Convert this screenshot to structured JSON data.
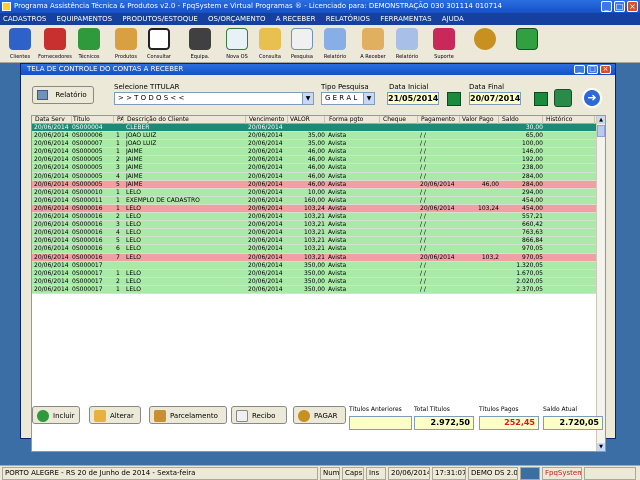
{
  "app": {
    "title": "Programa Assistência Técnica & Produtos v2.0 - FpqSystem e Virtual Programas ® - Licenciado para: DEMONSTRAÇÃO 030 301114 010714"
  },
  "menu": [
    "CADASTROS",
    "EQUIPAMENTOS",
    "PRODUTOS/ESTOQUE",
    "OS/ORÇAMENTO",
    "A RECEBER",
    "RELATÓRIOS",
    "FERRAMENTAS",
    "AJUDA"
  ],
  "toolbar": [
    {
      "label": "Clientes",
      "icon": "clients-icon"
    },
    {
      "label": "Fornecedores",
      "icon": "suppliers-icon"
    },
    {
      "label": "Técnicos",
      "icon": "technicians-icon"
    },
    {
      "label": "Produtos",
      "icon": "products-icon"
    },
    {
      "label": "Consultar",
      "icon": "barcode-icon"
    },
    {
      "label": "Equipa.",
      "icon": "equipment-icon"
    },
    {
      "label": "Nova OS",
      "icon": "new-os-icon"
    },
    {
      "label": "Consulta",
      "icon": "folder-icon"
    },
    {
      "label": "Pesquisa",
      "icon": "search-docs-icon"
    },
    {
      "label": "Relatório",
      "icon": "report-icon"
    },
    {
      "label": "A Receber",
      "icon": "receivables-icon"
    },
    {
      "label": "Relatório",
      "icon": "report2-icon"
    },
    {
      "label": "Suporte",
      "icon": "support-icon"
    },
    {
      "label": "",
      "icon": "coins-icon"
    },
    {
      "label": "",
      "icon": "exit-icon"
    }
  ],
  "window": {
    "title": "TELA DE CONTROLE DO CONTAS A RECEBER"
  },
  "filters": {
    "relatorio_label": "Relatório",
    "titular_label": "Selecione TITULAR",
    "titular_value": "> > T O D O S < <",
    "tipo_label": "Tipo  Pesquisa",
    "tipo_value": "G E R A L",
    "data_inicial_label": "Data Inicial",
    "data_inicial": "21/05/2014",
    "data_final_label": "Data Final",
    "data_final": "20/07/2014"
  },
  "table": {
    "headers": [
      "Data Serv",
      "Título",
      "PA",
      "Descrição do Cliente",
      "Vencimento",
      "VALOR",
      "Forma pgto",
      "Cheque",
      "Pagamento",
      "Valor Pago",
      "Saldo",
      "Histórico"
    ],
    "rows": [
      {
        "s": "sel",
        "d": "20/06/2014",
        "t": "0S000004",
        "pa": "",
        "cli": "CLEBER",
        "v": "20/06/2014",
        "val": "",
        "fp": "",
        "ch": "",
        "pg": "",
        "vp": "",
        "sd": "30,00",
        "h": ""
      },
      {
        "s": "g",
        "d": "20/06/2014",
        "t": "0S000006",
        "pa": "1",
        "cli": "JOÃO LUIZ",
        "v": "20/06/2014",
        "val": "35,00",
        "fp": "Avista",
        "ch": "",
        "pg": "/ /",
        "vp": "",
        "sd": "65,00",
        "h": ""
      },
      {
        "s": "g",
        "d": "20/06/2014",
        "t": "0S000007",
        "pa": "1",
        "cli": "JOÃO LUIZ",
        "v": "20/06/2014",
        "val": "35,00",
        "fp": "Avista",
        "ch": "",
        "pg": "/ /",
        "vp": "",
        "sd": "100,00",
        "h": ""
      },
      {
        "s": "g",
        "d": "20/06/2014",
        "t": "0S000005",
        "pa": "1",
        "cli": "JAIME",
        "v": "20/06/2014",
        "val": "46,00",
        "fp": "Avista",
        "ch": "",
        "pg": "/ /",
        "vp": "",
        "sd": "146,00",
        "h": ""
      },
      {
        "s": "g",
        "d": "20/06/2014",
        "t": "0S000005",
        "pa": "2",
        "cli": "JAIME",
        "v": "20/06/2014",
        "val": "46,00",
        "fp": "Avista",
        "ch": "",
        "pg": "/ /",
        "vp": "",
        "sd": "192,00",
        "h": ""
      },
      {
        "s": "g",
        "d": "20/06/2014",
        "t": "0S000005",
        "pa": "3",
        "cli": "JAIME",
        "v": "20/06/2014",
        "val": "46,00",
        "fp": "Avista",
        "ch": "",
        "pg": "/ /",
        "vp": "",
        "sd": "238,00",
        "h": ""
      },
      {
        "s": "g",
        "d": "20/06/2014",
        "t": "0S000005",
        "pa": "4",
        "cli": "JAIME",
        "v": "20/06/2014",
        "val": "46,00",
        "fp": "Avista",
        "ch": "",
        "pg": "/ /",
        "vp": "",
        "sd": "284,00",
        "h": ""
      },
      {
        "s": "r",
        "d": "20/06/2014",
        "t": "0S000005",
        "pa": "5",
        "cli": "JAIME",
        "v": "20/06/2014",
        "val": "46,00",
        "fp": "Avista",
        "ch": "",
        "pg": "20/06/2014",
        "vp": "46,00",
        "sd": "284,00",
        "h": ""
      },
      {
        "s": "g",
        "d": "20/06/2014",
        "t": "0S000010",
        "pa": "1",
        "cli": "LELO",
        "v": "20/06/2014",
        "val": "10,00",
        "fp": "Avista",
        "ch": "",
        "pg": "/ /",
        "vp": "",
        "sd": "294,00",
        "h": ""
      },
      {
        "s": "g",
        "d": "20/06/2014",
        "t": "0S000011",
        "pa": "1",
        "cli": "EXEMPLO DE CADASTRO",
        "v": "20/06/2014",
        "val": "160,00",
        "fp": "Avista",
        "ch": "",
        "pg": "/ /",
        "vp": "",
        "sd": "454,00",
        "h": ""
      },
      {
        "s": "r",
        "d": "20/06/2014",
        "t": "0S000016",
        "pa": "1",
        "cli": "LELO",
        "v": "20/06/2014",
        "val": "103,24",
        "fp": "Avista",
        "ch": "",
        "pg": "20/06/2014",
        "vp": "103,24",
        "sd": "454,00",
        "h": ""
      },
      {
        "s": "g",
        "d": "20/06/2014",
        "t": "0S000016",
        "pa": "2",
        "cli": "LELO",
        "v": "20/06/2014",
        "val": "103,21",
        "fp": "Avista",
        "ch": "",
        "pg": "/ /",
        "vp": "",
        "sd": "557,21",
        "h": ""
      },
      {
        "s": "g",
        "d": "20/06/2014",
        "t": "0S000016",
        "pa": "3",
        "cli": "LELO",
        "v": "20/06/2014",
        "val": "103,21",
        "fp": "Avista",
        "ch": "",
        "pg": "/ /",
        "vp": "",
        "sd": "660,42",
        "h": ""
      },
      {
        "s": "g",
        "d": "20/06/2014",
        "t": "0S000016",
        "pa": "4",
        "cli": "LELO",
        "v": "20/06/2014",
        "val": "103,21",
        "fp": "Avista",
        "ch": "",
        "pg": "/ /",
        "vp": "",
        "sd": "763,63",
        "h": ""
      },
      {
        "s": "g",
        "d": "20/06/2014",
        "t": "0S000016",
        "pa": "5",
        "cli": "LELO",
        "v": "20/06/2014",
        "val": "103,21",
        "fp": "Avista",
        "ch": "",
        "pg": "/ /",
        "vp": "",
        "sd": "866,84",
        "h": ""
      },
      {
        "s": "g",
        "d": "20/06/2014",
        "t": "0S000016",
        "pa": "6",
        "cli": "LELO",
        "v": "20/06/2014",
        "val": "103,21",
        "fp": "Avista",
        "ch": "",
        "pg": "/ /",
        "vp": "",
        "sd": "970,05",
        "h": ""
      },
      {
        "s": "r",
        "d": "20/06/2014",
        "t": "0S000016",
        "pa": "7",
        "cli": "LELO",
        "v": "20/06/2014",
        "val": "103,21",
        "fp": "Avista",
        "ch": "",
        "pg": "20/06/2014",
        "vp": "103,2",
        "sd": "970,05",
        "h": ""
      },
      {
        "s": "g",
        "d": "20/06/2014",
        "t": "0S000017",
        "pa": "",
        "cli": "",
        "v": "20/06/2014",
        "val": "350,00",
        "fp": "Avista",
        "ch": "",
        "pg": "/ /",
        "vp": "",
        "sd": "1.320,05",
        "h": ""
      },
      {
        "s": "g",
        "d": "20/06/2014",
        "t": "0S000017",
        "pa": "1",
        "cli": "LELO",
        "v": "20/06/2014",
        "val": "350,00",
        "fp": "Avista",
        "ch": "",
        "pg": "/ /",
        "vp": "",
        "sd": "1.670,05",
        "h": ""
      },
      {
        "s": "g",
        "d": "20/06/2014",
        "t": "0S000017",
        "pa": "2",
        "cli": "LELO",
        "v": "20/06/2014",
        "val": "350,00",
        "fp": "Avista",
        "ch": "",
        "pg": "/ /",
        "vp": "",
        "sd": "2.020,05",
        "h": ""
      },
      {
        "s": "g",
        "d": "20/06/2014",
        "t": "0S000017",
        "pa": "1",
        "cli": "LELO",
        "v": "20/06/2014",
        "val": "350,00",
        "fp": "Avista",
        "ch": "",
        "pg": "/ /",
        "vp": "",
        "sd": "2.370,05",
        "h": ""
      }
    ]
  },
  "buttons": {
    "incluir": "Incluir",
    "alterar": "Alterar",
    "parcelamento": "Parcelamento",
    "recibo": "Recibo",
    "pagar": "PAGAR"
  },
  "totals": {
    "anteriores_label": "Títulos Anteriores",
    "anteriores_value": "",
    "total_label": "Total Títulos",
    "total_value": "2.972,50",
    "pagos_label": "Títulos Pagos",
    "pagos_value": "252,45",
    "saldo_label": "Saldo Atual",
    "saldo_value": "2.720,05"
  },
  "colors": {
    "paid_row": "#f0a0a0",
    "open_row": "#a9eaa9",
    "selected_row": "#1c8a78",
    "pagos_text": "#d81818"
  },
  "status": {
    "location": "PORTO ALEGRE - RS 20 de Junho de 2014 - Sexta-feira",
    "num": "Num",
    "caps": "Caps",
    "ins": "Ins",
    "date": "20/06/2014",
    "time": "17:31:07",
    "demo": "DEMO DS 2.0",
    "brand": "FpqSystem"
  }
}
